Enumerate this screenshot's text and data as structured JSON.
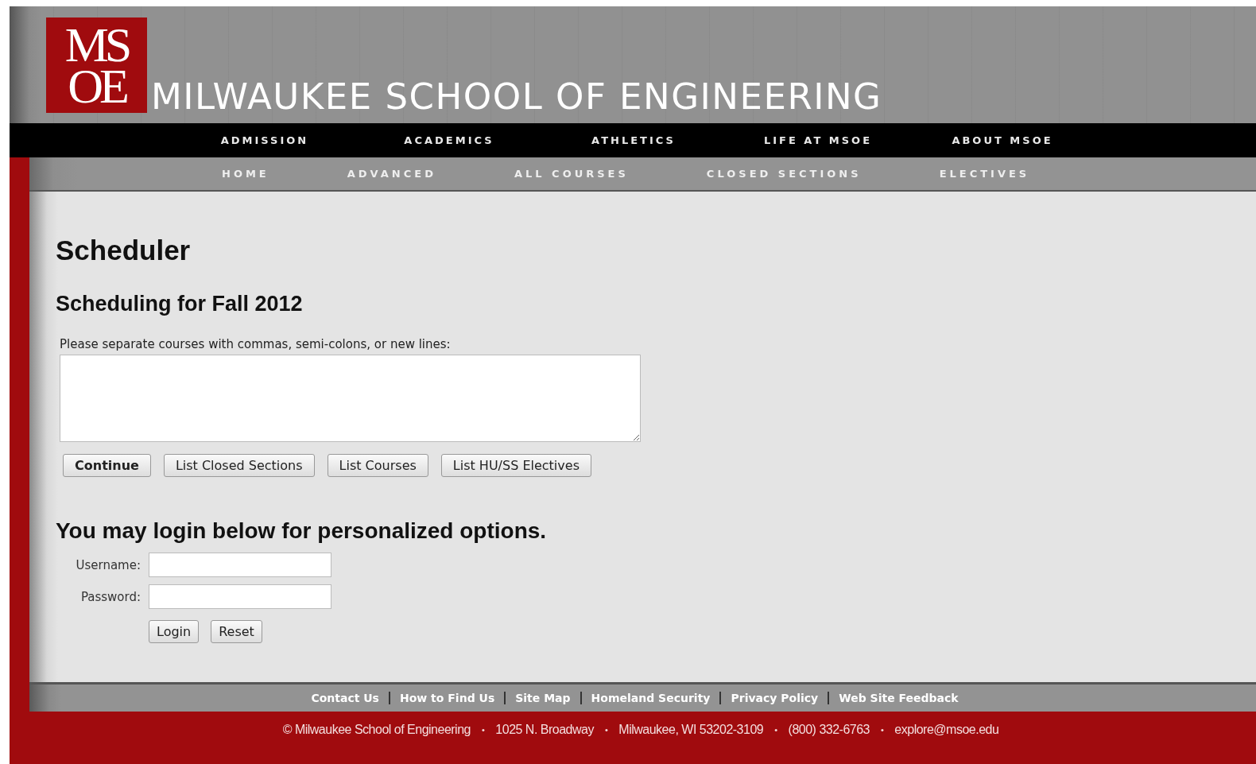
{
  "header": {
    "logo_lines": [
      "MS",
      "OE"
    ],
    "title": "MILWAUKEE SCHOOL OF ENGINEERING"
  },
  "main_nav": [
    "ADMISSION",
    "ACADEMICS",
    "ATHLETICS",
    "LIFE AT MSOE",
    "ABOUT MSOE"
  ],
  "sub_nav": [
    "HOME",
    "ADVANCED",
    "ALL COURSES",
    "CLOSED SECTIONS",
    "ELECTIVES"
  ],
  "page_title": "Scheduler",
  "scheduler": {
    "heading": "Scheduling for Fall 2012",
    "label": "Please separate courses with commas, semi-colons, or new lines:",
    "buttons": [
      {
        "label": "Continue",
        "primary": true
      },
      {
        "label": "List Closed Sections",
        "primary": false
      },
      {
        "label": "List Courses",
        "primary": false
      },
      {
        "label": "List HU/SS Electives",
        "primary": false
      }
    ]
  },
  "login": {
    "heading": "You may login below for personalized options.",
    "fields": [
      "Username:",
      "Password:"
    ],
    "buttons": [
      "Login",
      "Reset"
    ]
  },
  "footer_links": [
    "Contact Us",
    "How to Find Us",
    "Site Map",
    "Homeland Security",
    "Privacy Policy",
    "Web Site Feedback"
  ],
  "footer_info": [
    {
      "kind": "text",
      "text": "© Milwaukee School of Engineering"
    },
    {
      "kind": "bullet",
      "text": "•"
    },
    {
      "kind": "text",
      "text": "1025 N. Broadway"
    },
    {
      "kind": "bullet",
      "text": "•"
    },
    {
      "kind": "text",
      "text": "Milwaukee, WI 53202-3109"
    },
    {
      "kind": "bullet",
      "text": "•"
    },
    {
      "kind": "text",
      "text": "(800) 332-6763"
    },
    {
      "kind": "bullet",
      "text": "•"
    },
    {
      "kind": "text",
      "text": "explore@msoe.edu"
    }
  ]
}
